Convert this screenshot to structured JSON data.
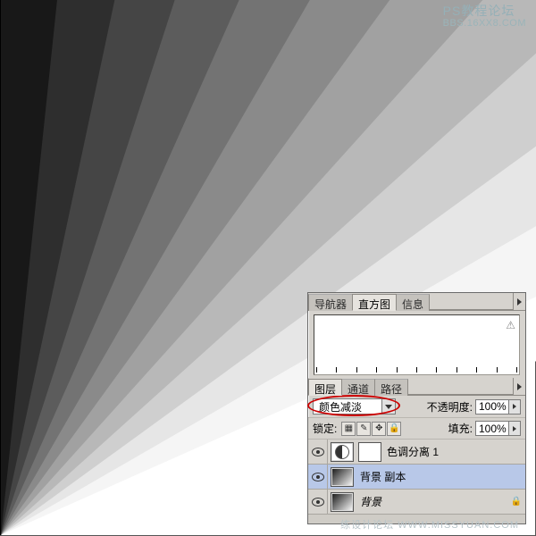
{
  "watermark": {
    "top_line1": "PS教程论坛",
    "top_line2": "BBS.16XX8.COM",
    "bottom": "练设计论坛 WWW.MISSYUAN.COM"
  },
  "nav_panel": {
    "tabs": {
      "navigator": "导航器",
      "histogram": "直方图",
      "info": "信息"
    }
  },
  "layers_panel": {
    "tabs": {
      "layers": "图层",
      "channels": "通道",
      "paths": "路径"
    },
    "blend_mode": "颜色减淡",
    "opacity_label": "不透明度:",
    "opacity_value": "100%",
    "lock_label": "锁定:",
    "fill_label": "填充:",
    "fill_value": "100%",
    "lock_icons": {
      "pixels": "▦",
      "brush": "✎",
      "move": "✥",
      "all": "🔒"
    },
    "layers": [
      {
        "name": "色调分离 1",
        "thumb": "adj",
        "has_mask": true,
        "selected": false
      },
      {
        "name": "背景 副本",
        "thumb": "grad",
        "has_mask": false,
        "selected": true
      },
      {
        "name": "背景",
        "thumb": "grad",
        "has_mask": false,
        "locked": true,
        "selected": false
      }
    ]
  },
  "gradient_bands": [
    {
      "angle": 0,
      "color": "#000000"
    },
    {
      "angle": 6,
      "color": "#181818"
    },
    {
      "angle": 12,
      "color": "#2e2e2e"
    },
    {
      "angle": 18,
      "color": "#454545"
    },
    {
      "angle": 24,
      "color": "#5c5c5c"
    },
    {
      "angle": 30,
      "color": "#737373"
    },
    {
      "angle": 36,
      "color": "#8a8a8a"
    },
    {
      "angle": 42,
      "color": "#a1a1a1"
    },
    {
      "angle": 48,
      "color": "#b8b8b8"
    },
    {
      "angle": 54,
      "color": "#cfcfcf"
    },
    {
      "angle": 60,
      "color": "#e6e6e6"
    },
    {
      "angle": 66,
      "color": "#f5f5f5"
    },
    {
      "angle": 72,
      "color": "#ffffff"
    }
  ]
}
